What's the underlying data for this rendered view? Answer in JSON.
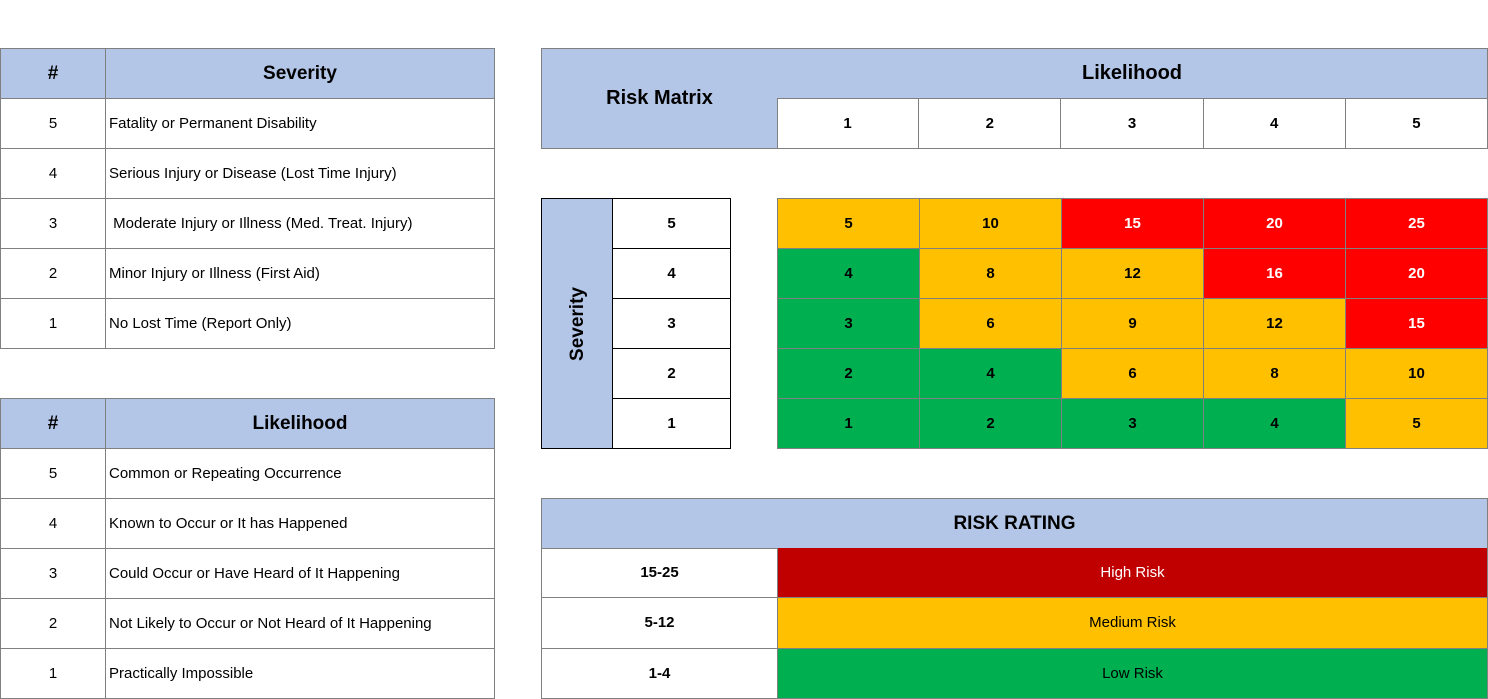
{
  "severity_table": {
    "header": {
      "num": "#",
      "label": "Severity"
    },
    "rows": [
      {
        "num": "5",
        "label": "Fatality or Permanent Disability"
      },
      {
        "num": "4",
        "label": "Serious Injury or Disease (Lost Time Injury)"
      },
      {
        "num": "3",
        "label": " Moderate Injury or Illness (Med. Treat. Injury)"
      },
      {
        "num": "2",
        "label": "Minor Injury or Illness (First Aid)"
      },
      {
        "num": "1",
        "label": "No Lost Time (Report Only)"
      }
    ]
  },
  "likelihood_table": {
    "header": {
      "num": "#",
      "label": "Likelihood"
    },
    "rows": [
      {
        "num": "5",
        "label": "Common or Repeating Occurrence"
      },
      {
        "num": "4",
        "label": "Known to Occur or It has Happened"
      },
      {
        "num": "3",
        "label": "Could Occur or Have Heard of It Happening"
      },
      {
        "num": "2",
        "label": "Not Likely to Occur or Not Heard of It Happening"
      },
      {
        "num": "1",
        "label": "Practically Impossible"
      }
    ]
  },
  "risk_matrix": {
    "title": "Risk Matrix",
    "likelihood_label": "Likelihood",
    "severity_label": "Severity",
    "likelihood_levels": [
      "1",
      "2",
      "3",
      "4",
      "5"
    ],
    "severity_levels": [
      "5",
      "4",
      "3",
      "2",
      "1"
    ],
    "grid": [
      [
        {
          "v": "5",
          "r": "medium"
        },
        {
          "v": "10",
          "r": "medium"
        },
        {
          "v": "15",
          "r": "high"
        },
        {
          "v": "20",
          "r": "high"
        },
        {
          "v": "25",
          "r": "high"
        }
      ],
      [
        {
          "v": "4",
          "r": "low"
        },
        {
          "v": "8",
          "r": "medium"
        },
        {
          "v": "12",
          "r": "medium"
        },
        {
          "v": "16",
          "r": "high"
        },
        {
          "v": "20",
          "r": "high"
        }
      ],
      [
        {
          "v": "3",
          "r": "low"
        },
        {
          "v": "6",
          "r": "medium"
        },
        {
          "v": "9",
          "r": "medium"
        },
        {
          "v": "12",
          "r": "medium"
        },
        {
          "v": "15",
          "r": "high"
        }
      ],
      [
        {
          "v": "2",
          "r": "low"
        },
        {
          "v": "4",
          "r": "low"
        },
        {
          "v": "6",
          "r": "medium"
        },
        {
          "v": "8",
          "r": "medium"
        },
        {
          "v": "10",
          "r": "medium"
        }
      ],
      [
        {
          "v": "1",
          "r": "low"
        },
        {
          "v": "2",
          "r": "low"
        },
        {
          "v": "3",
          "r": "low"
        },
        {
          "v": "4",
          "r": "low"
        },
        {
          "v": "5",
          "r": "medium"
        }
      ]
    ],
    "colors": {
      "high": "#ff0000",
      "medium": "#ffc000",
      "low": "#00b050"
    },
    "text_colors": {
      "high": "#ffffff",
      "medium": "#000000",
      "low": "#000000"
    }
  },
  "risk_rating": {
    "title": "RISK RATING",
    "rows": [
      {
        "range": "15-25",
        "label": "High Risk",
        "color": "#c00000",
        "text_color": "#ffffff"
      },
      {
        "range": "5-12",
        "label": "Medium Risk",
        "color": "#ffc000",
        "text_color": "#000000"
      },
      {
        "range": "1-4",
        "label": "Low Risk",
        "color": "#00b050",
        "text_color": "#000000"
      }
    ]
  },
  "colors": {
    "header_bg": "#b4c6e7",
    "grid_border": "#808080"
  }
}
